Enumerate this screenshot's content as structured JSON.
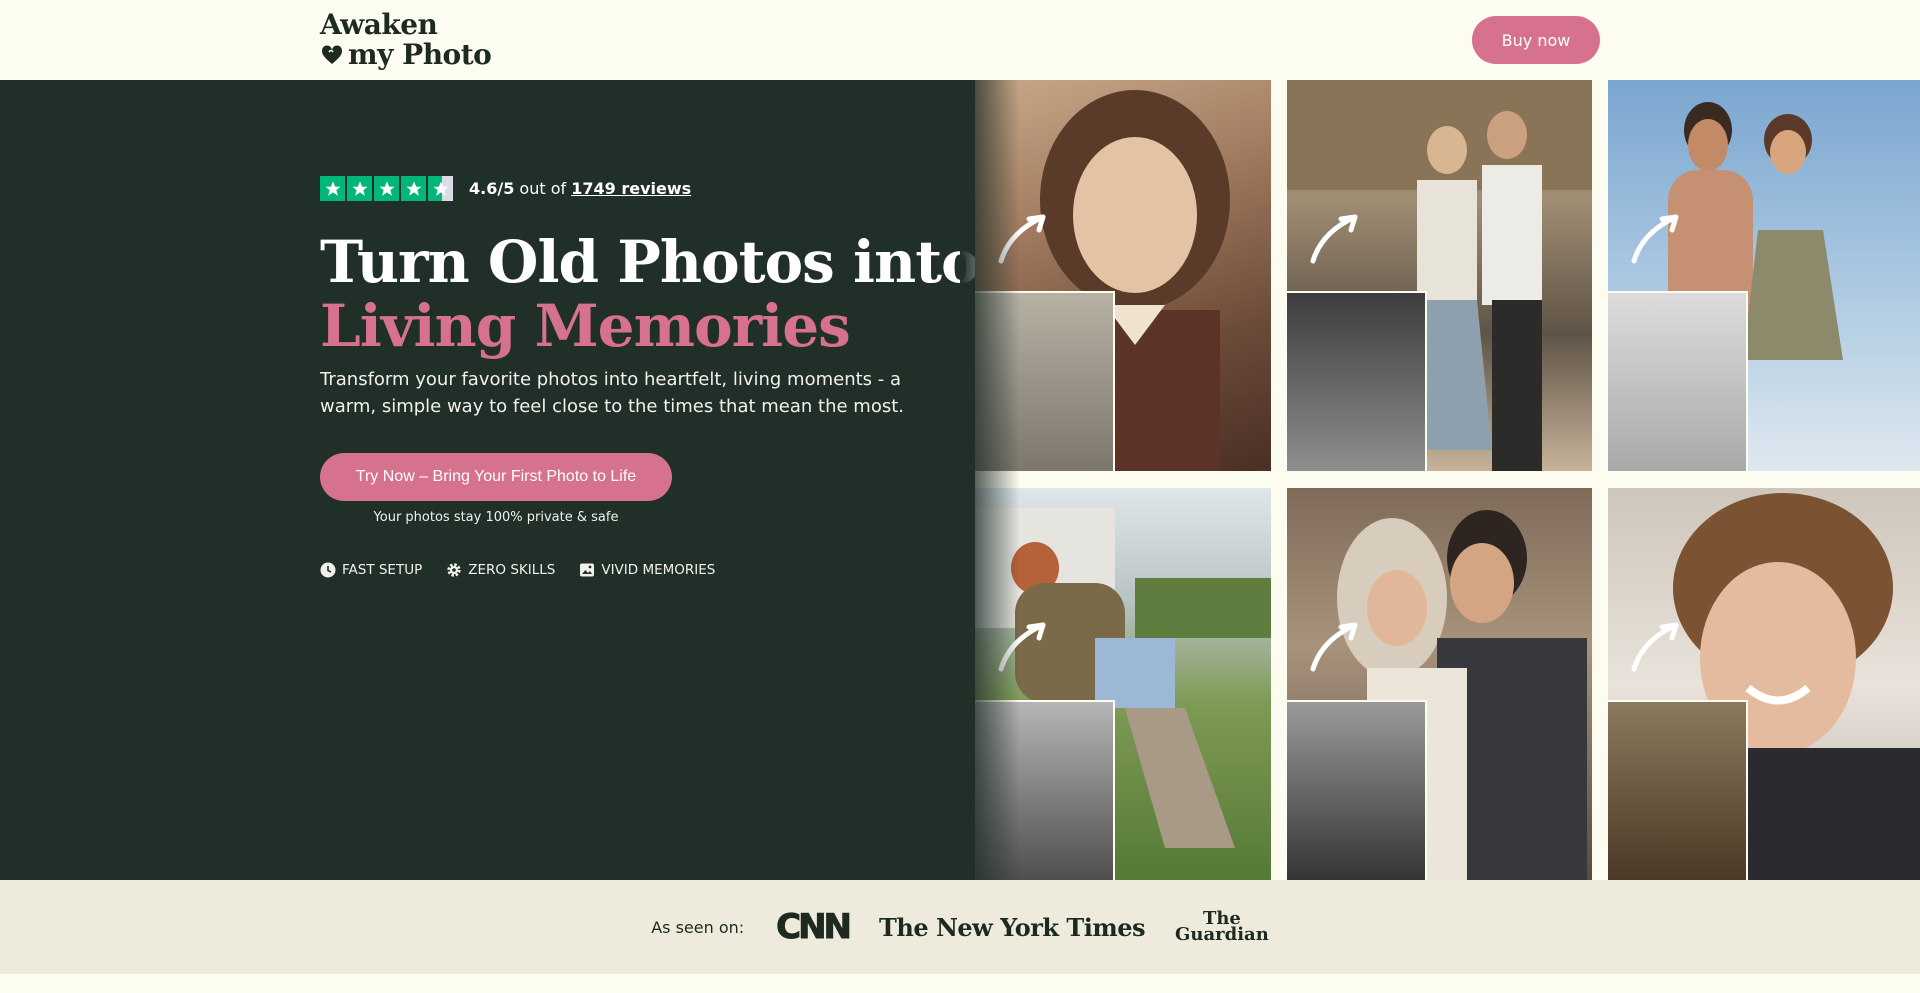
{
  "header": {
    "logo_line1": "Awaken",
    "logo_line2": "my Photo",
    "buy_button": "Buy now"
  },
  "hero": {
    "rating": {
      "stars": 4.6,
      "score": "4.6/5",
      "out_of": "out of",
      "reviews_link": "1749 reviews"
    },
    "headline_line1": "Turn Old Photos into",
    "headline_line2": "Living Memories",
    "subtext": "Transform your favorite photos into heartfelt, living moments - a warm, simple way to feel close to the times that mean the most.",
    "cta_button": "Try Now – Bring Your First Photo to Life",
    "privacy_note": "Your photos stay 100% private & safe",
    "features": [
      {
        "icon": "clock-icon",
        "label": "FAST SETUP"
      },
      {
        "icon": "gear-icon",
        "label": "ZERO SKILLS"
      },
      {
        "icon": "image-icon",
        "label": "VIVID MEMORIES"
      }
    ]
  },
  "press": {
    "label": "As seen on:",
    "logos": [
      "CNN",
      "The New York Times",
      "The Guardian"
    ],
    "guardian_line1": "The",
    "guardian_line2": "Guardian"
  },
  "colors": {
    "hero_bg": "#212f29",
    "accent_pink": "#d6718e",
    "page_bg": "#fdfcf1",
    "press_bg": "#efebdc",
    "trustpilot_green": "#00b67a"
  }
}
